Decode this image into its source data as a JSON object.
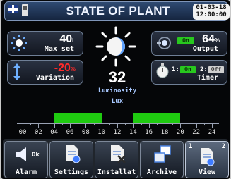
{
  "header": {
    "title": "STATE OF PLANT",
    "date": "01-03-18",
    "time": "12:00:00"
  },
  "icons": {
    "flag": "uk-flag-icon",
    "storage": "sd-card-icon",
    "sun": "sun-icon",
    "moon": "moon-icon"
  },
  "panels": {
    "max_set": {
      "value": "40",
      "unit": "L",
      "label": "Max set"
    },
    "variation": {
      "value": "-20",
      "unit": "%",
      "label": "Variation"
    },
    "output": {
      "status": "On",
      "value": "64",
      "unit": "%",
      "label": "Output"
    },
    "timer": {
      "t1_num": "1:",
      "t1_status": "On",
      "t2_num": "2:",
      "t2_status": "Off",
      "label": "Timer"
    }
  },
  "luminosity": {
    "value": "32",
    "label": "Luminosity",
    "unit": "Lux"
  },
  "timeline": {
    "ticks": [
      "00",
      "02",
      "04",
      "06",
      "08",
      "10",
      "12",
      "14",
      "16",
      "18",
      "20",
      "22",
      "24"
    ],
    "on_periods": [
      [
        4,
        10
      ],
      [
        14,
        20
      ]
    ]
  },
  "bottom": {
    "alarm": {
      "label": "Alarm",
      "status": "Ok"
    },
    "settings": {
      "label": "Settings"
    },
    "install": {
      "label": "Installat"
    },
    "archive": {
      "label": "Archive"
    },
    "view": {
      "label": "View",
      "page_left": "1",
      "page_right": "2"
    }
  },
  "colors": {
    "accent": "#1fcb10",
    "negative": "#ff2a2a",
    "luminosity_label": "#a8c8ff"
  }
}
